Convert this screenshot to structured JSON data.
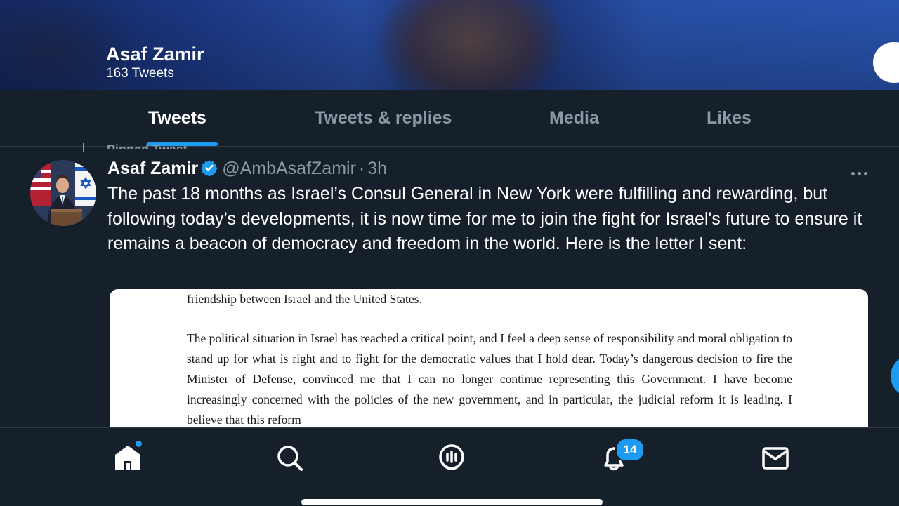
{
  "header": {
    "name": "Asaf Zamir",
    "tweet_count": "163 Tweets"
  },
  "tabs": [
    {
      "label": "Tweets",
      "active": true
    },
    {
      "label": "Tweets & replies",
      "active": false
    },
    {
      "label": "Media",
      "active": false
    },
    {
      "label": "Likes",
      "active": false
    }
  ],
  "pinned_label": "Pinned Tweet",
  "tweet": {
    "author": "Asaf Zamir",
    "verified": true,
    "handle": "@AmbAsafZamir",
    "separator": "·",
    "time": "3h",
    "text": "The past 18 months as Israel’s Consul General in New York were fulfilling and rewarding, but following today’s developments, it is now time for me to join the fight for Israel's future to ensure it remains a beacon of democracy and freedom in the world. Here is the letter I sent:",
    "letter": {
      "line1": "friendship between Israel and the United States.",
      "paragraph": "The political situation in Israel has reached a critical point, and I feel a deep sense of responsibility and moral obligation to stand up for what is right and to fight for the democratic values that I hold dear. Today’s dangerous decision to fire the Minister of Defense, convinced me that I can no longer continue representing this Government. I have become increasingly concerned with the policies of the new government, and in particular, the judicial reform it is leading. I believe that this reform"
    }
  },
  "nav": {
    "items": [
      "home-icon",
      "search-icon",
      "spaces-icon",
      "notifications-icon",
      "messages-icon"
    ],
    "notifications_badge": "14"
  },
  "colors": {
    "background": "#15202b",
    "accent": "#1d9bf0",
    "secondary_text": "#8b98a5"
  }
}
